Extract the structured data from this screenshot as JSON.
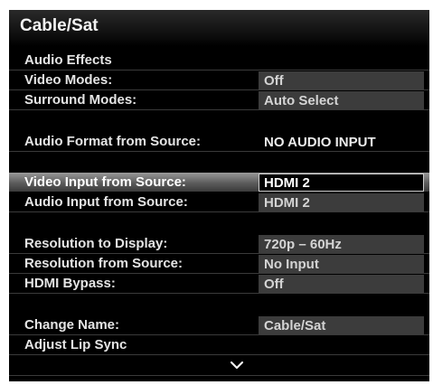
{
  "menu": {
    "title": "Cable/Sat",
    "rows": [
      {
        "label": "Audio Effects",
        "value": null
      },
      {
        "label": "Video Modes:",
        "value": "Off"
      },
      {
        "label": "Surround Modes:",
        "value": "Auto Select"
      },
      {
        "label": "Audio Format from Source:",
        "value": "NO AUDIO INPUT"
      },
      {
        "label": "Video Input from Source:",
        "value": "HDMI 2",
        "selected": true
      },
      {
        "label": "Audio Input from Source:",
        "value": "HDMI 2"
      },
      {
        "label": "Resolution to Display:",
        "value": "720p – 60Hz"
      },
      {
        "label": "Resolution from Source:",
        "value": "No Input"
      },
      {
        "label": "HDMI Bypass:",
        "value": "Off"
      },
      {
        "label": "Change Name:",
        "value": "Cable/Sat"
      },
      {
        "label": "Adjust Lip Sync",
        "value": null
      }
    ],
    "scroll_icon": "chevron-down-icon"
  },
  "colors": {
    "background": "#000000",
    "value_box": "#3c3c3c",
    "highlight": "#8a8a8a",
    "text": "#e4e4e4"
  }
}
